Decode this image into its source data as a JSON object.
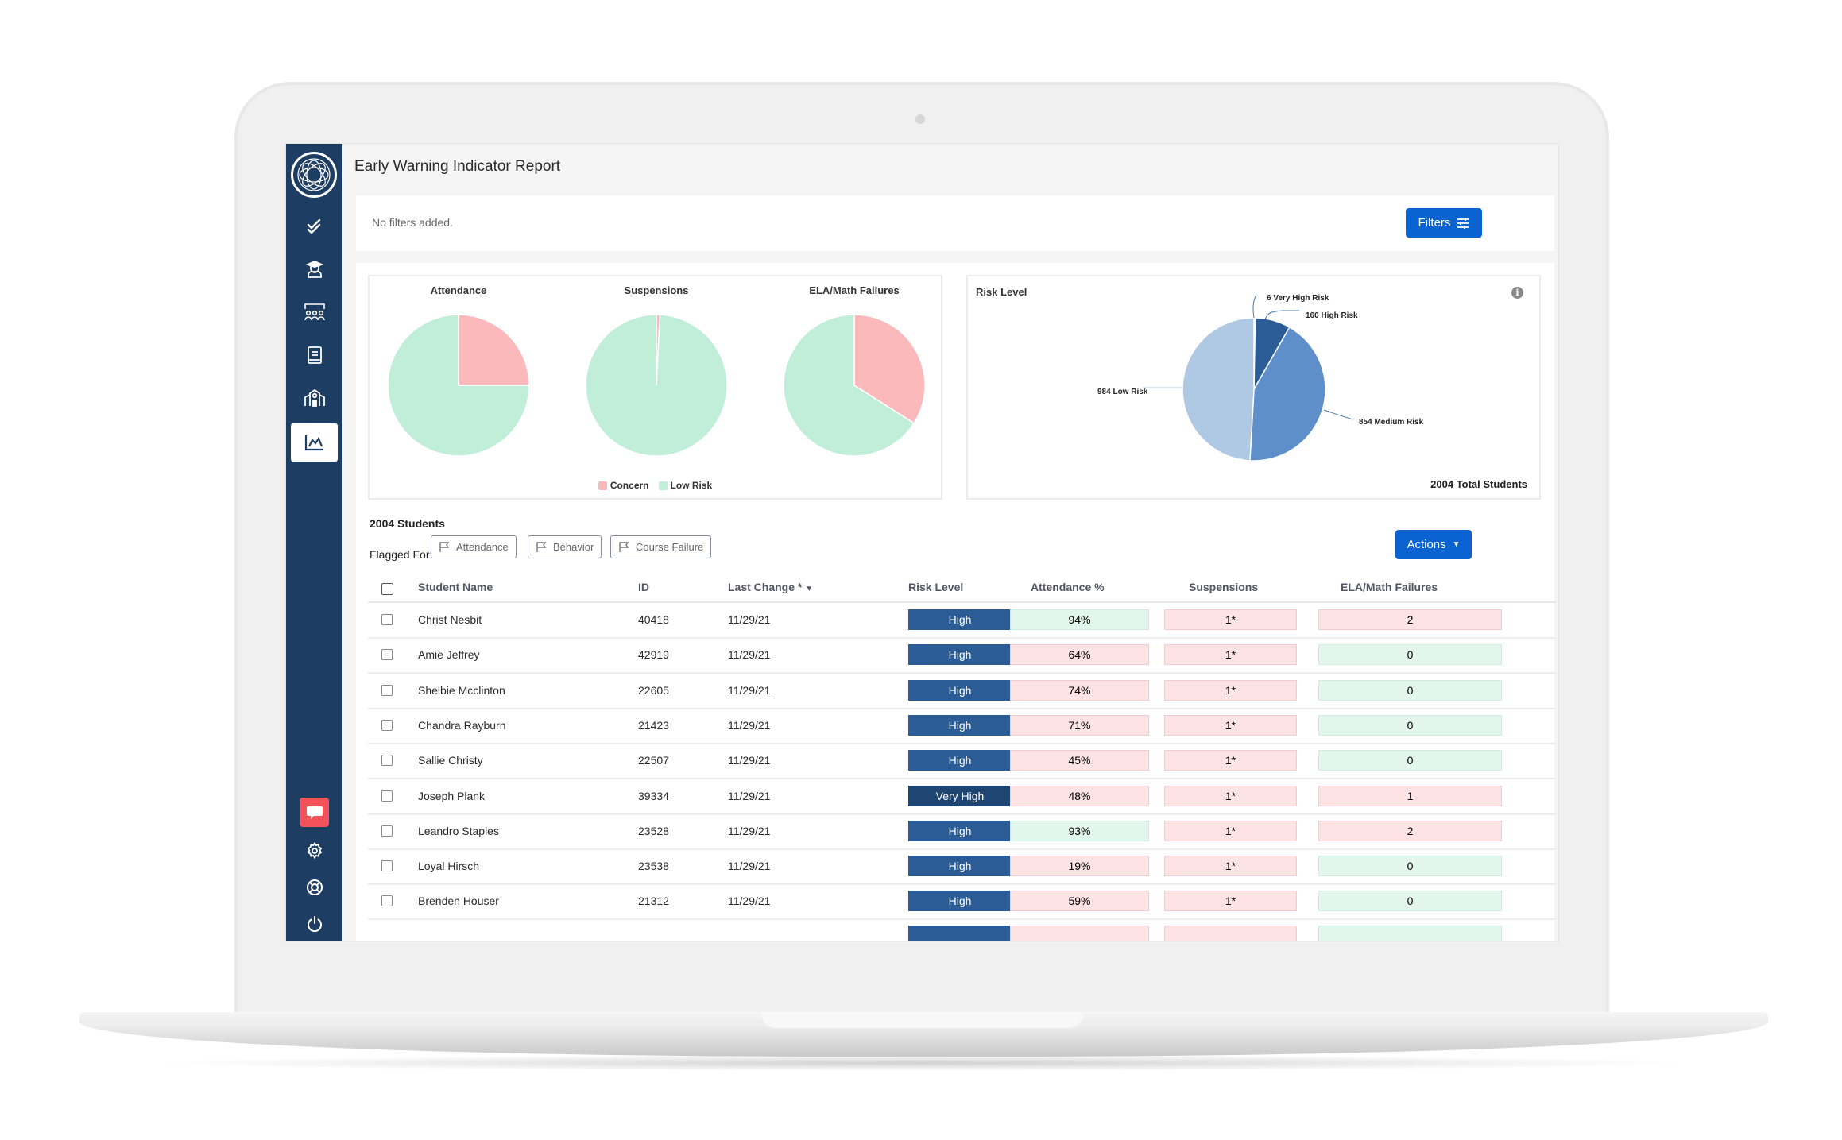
{
  "app": {
    "title": "Early Warning Indicator Report"
  },
  "sidebar": {
    "items": [
      {
        "name": "tasks",
        "icon": "check-double-icon"
      },
      {
        "name": "students",
        "icon": "graduate-icon"
      },
      {
        "name": "groups",
        "icon": "group-icon"
      },
      {
        "name": "resources",
        "icon": "book-icon"
      },
      {
        "name": "schools",
        "icon": "school-icon"
      },
      {
        "name": "reports",
        "icon": "chart-area-icon",
        "active": true
      }
    ],
    "bottom_items": [
      {
        "name": "feedback",
        "icon": "chat-icon"
      },
      {
        "name": "settings",
        "icon": "gear-icon"
      },
      {
        "name": "help",
        "icon": "lifebuoy-icon"
      },
      {
        "name": "logout",
        "icon": "power-icon"
      }
    ]
  },
  "filters": {
    "status_text": "No filters added.",
    "button_label": "Filters"
  },
  "chart_data": [
    {
      "type": "pie",
      "title": "Attendance",
      "labels": [
        "Concern",
        "Low Risk"
      ],
      "values_percent": [
        25,
        75
      ]
    },
    {
      "type": "pie",
      "title": "Suspensions",
      "labels": [
        "Concern",
        "Low Risk"
      ],
      "values_percent": [
        0.8,
        99.2
      ]
    },
    {
      "type": "pie",
      "title": "ELA/Math Failures",
      "labels": [
        "Concern",
        "Low Risk"
      ],
      "values_percent": [
        34,
        66
      ]
    },
    {
      "type": "pie",
      "title": "Risk Level",
      "labels": [
        "Very High Risk",
        "High Risk",
        "Medium Risk",
        "Low Risk"
      ],
      "values": [
        6,
        160,
        854,
        984
      ],
      "data_labels": [
        "6 Very High Risk",
        "160 High Risk",
        "854 Medium Risk",
        "984 Low Risk"
      ],
      "colors": [
        "#1f4573",
        "#2b5c95",
        "#5e8fcb",
        "#afc8e3"
      ],
      "footer": "2004 Total Students"
    }
  ],
  "pie_legend": [
    {
      "label": "Concern",
      "color": "#fbb9bb"
    },
    {
      "label": "Low Risk",
      "color": "#c1eed9"
    }
  ],
  "students": {
    "count_label": "2004 Students",
    "flagged_label": "Flagged For:",
    "flags": [
      "Attendance",
      "Behavior",
      "Course Failure"
    ],
    "actions_label": "Actions"
  },
  "table": {
    "columns": [
      "Student Name",
      "ID",
      "Last Change *",
      "Risk Level",
      "Attendance %",
      "Suspensions",
      "ELA/Math Failures"
    ],
    "rows": [
      {
        "name": "Christ Nesbit",
        "id": "40418",
        "last_change": "11/29/21",
        "risk": "High",
        "attendance": "94%",
        "attendance_status": "ok",
        "suspensions": "1*",
        "suspensions_status": "concern",
        "ela": "2",
        "ela_status": "concern"
      },
      {
        "name": "Amie Jeffrey",
        "id": "42919",
        "last_change": "11/29/21",
        "risk": "High",
        "attendance": "64%",
        "attendance_status": "concern",
        "suspensions": "1*",
        "suspensions_status": "concern",
        "ela": "0",
        "ela_status": "ok"
      },
      {
        "name": "Shelbie Mcclinton",
        "id": "22605",
        "last_change": "11/29/21",
        "risk": "High",
        "attendance": "74%",
        "attendance_status": "concern",
        "suspensions": "1*",
        "suspensions_status": "concern",
        "ela": "0",
        "ela_status": "ok"
      },
      {
        "name": "Chandra Rayburn",
        "id": "21423",
        "last_change": "11/29/21",
        "risk": "High",
        "attendance": "71%",
        "attendance_status": "concern",
        "suspensions": "1*",
        "suspensions_status": "concern",
        "ela": "0",
        "ela_status": "ok"
      },
      {
        "name": "Sallie Christy",
        "id": "22507",
        "last_change": "11/29/21",
        "risk": "High",
        "attendance": "45%",
        "attendance_status": "concern",
        "suspensions": "1*",
        "suspensions_status": "concern",
        "ela": "0",
        "ela_status": "ok"
      },
      {
        "name": "Joseph Plank",
        "id": "39334",
        "last_change": "11/29/21",
        "risk": "Very High",
        "attendance": "48%",
        "attendance_status": "concern",
        "suspensions": "1*",
        "suspensions_status": "concern",
        "ela": "1",
        "ela_status": "concern"
      },
      {
        "name": "Leandro Staples",
        "id": "23528",
        "last_change": "11/29/21",
        "risk": "High",
        "attendance": "93%",
        "attendance_status": "ok",
        "suspensions": "1*",
        "suspensions_status": "concern",
        "ela": "2",
        "ela_status": "concern"
      },
      {
        "name": "Loyal Hirsch",
        "id": "23538",
        "last_change": "11/29/21",
        "risk": "High",
        "attendance": "19%",
        "attendance_status": "concern",
        "suspensions": "1*",
        "suspensions_status": "concern",
        "ela": "0",
        "ela_status": "ok"
      },
      {
        "name": "Brenden Houser",
        "id": "21312",
        "last_change": "11/29/21",
        "risk": "High",
        "attendance": "59%",
        "attendance_status": "concern",
        "suspensions": "1*",
        "suspensions_status": "concern",
        "ela": "0",
        "ela_status": "ok"
      }
    ]
  },
  "colors": {
    "sidebar": "#1e3d63",
    "primary_button": "#0b63d1",
    "risk_high": "#2b5c95",
    "risk_very_high": "#1f4573",
    "concern_bg": "#fde3e4",
    "ok_bg": "#e2f6ed",
    "feedback": "#f2525a"
  }
}
